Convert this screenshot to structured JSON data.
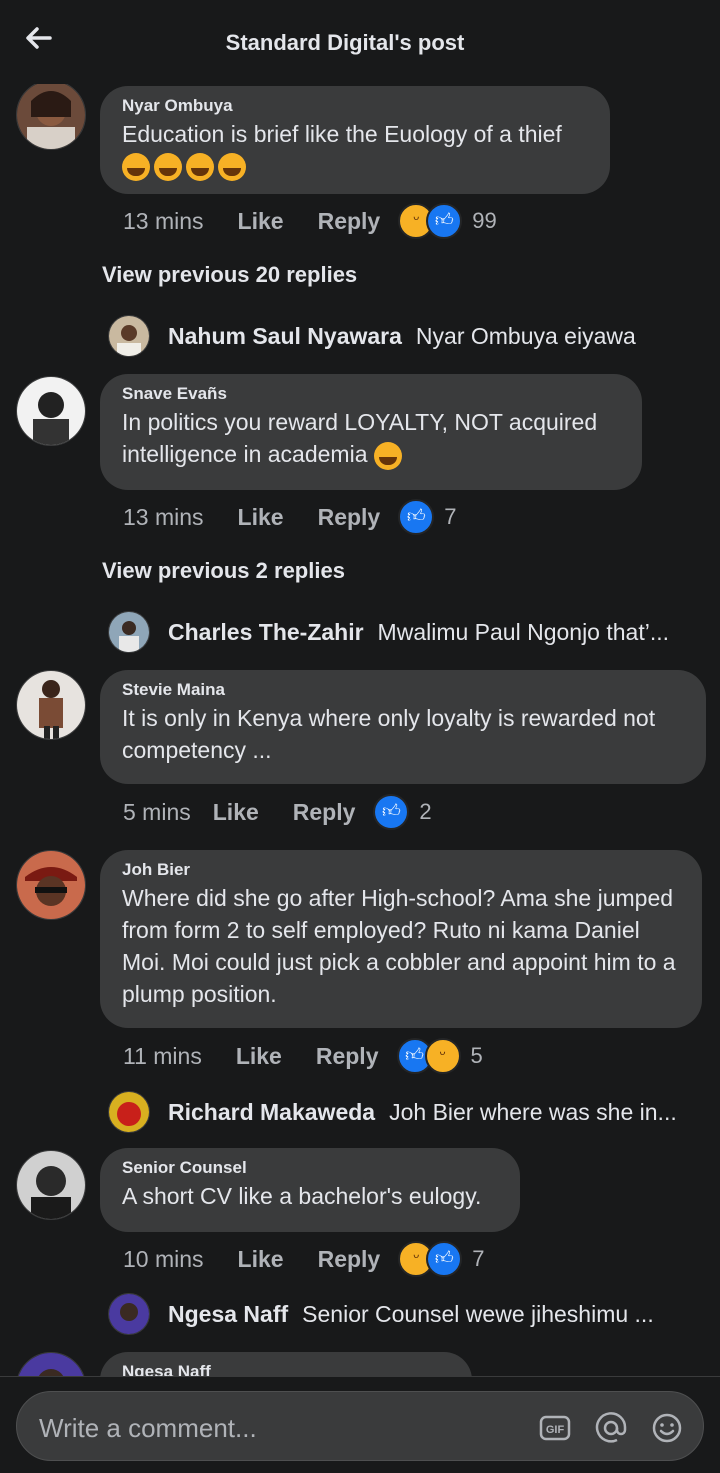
{
  "header": {
    "title": "Standard Digital's post",
    "back_icon": "arrow-left-icon"
  },
  "comments": [
    {
      "author": "Nyar Ombuya",
      "text": "Education is brief like the Euology of a thief",
      "emoji_line": "tears-of-joy x4",
      "time": "13 mins",
      "like": "Like",
      "reply": "Reply",
      "reactions": [
        "haha",
        "like"
      ],
      "count": "99",
      "view_previous": "View previous 20 replies",
      "preview_reply": {
        "name": "Nahum Saul Nyawara",
        "text": "Nyar Ombuya eiyawa"
      }
    },
    {
      "author": "Snave Evañs",
      "text": "In politics you reward LOYALTY, NOT acquired intelligence in academia",
      "time": "13 mins",
      "like": "Like",
      "reply": "Reply",
      "reactions": [
        "like"
      ],
      "count": "7",
      "view_previous": "View previous 2 replies",
      "preview_reply": {
        "name": "Charles The-Zahir",
        "text": "Mwalimu Paul Ngonjo that’..."
      }
    },
    {
      "author": "Stevie Maina",
      "text": "It is only in Kenya where  only loyalty is rewarded not competency ...",
      "time": "5 mins",
      "like": "Like",
      "reply": "Reply",
      "reactions": [
        "like"
      ],
      "count": "2"
    },
    {
      "author": "Joh Bier",
      "text": "Where did she go after High-school? Ama she jumped from form 2 to self employed? Ruto ni kama Daniel Moi. Moi could just pick a cobbler and appoint him to a plump position.",
      "time": "11 mins",
      "like": "Like",
      "reply": "Reply",
      "reactions": [
        "like",
        "haha"
      ],
      "count": "5",
      "preview_reply": {
        "name": "Richard Makaweda",
        "text": "Joh Bier where was she in..."
      }
    },
    {
      "author": "Senior Counsel",
      "text": "A short CV like a bachelor's eulogy.",
      "time": "10 mins",
      "like": "Like",
      "reply": "Reply",
      "reactions": [
        "haha",
        "like"
      ],
      "count": "7",
      "preview_reply": {
        "name": "Ngesa Naff",
        "text": "Senior Counsel wewe jiheshimu ..."
      }
    },
    {
      "author": "Ngesa Naff"
    }
  ],
  "composer": {
    "placeholder": "Write a comment...",
    "icons": [
      "gif-icon",
      "at-mention-icon",
      "emoji-icon"
    ]
  },
  "colors": {
    "background": "#18191a",
    "bubble": "#3a3b3c",
    "like_blue": "#1877f2",
    "haha_yellow": "#f7b125"
  }
}
